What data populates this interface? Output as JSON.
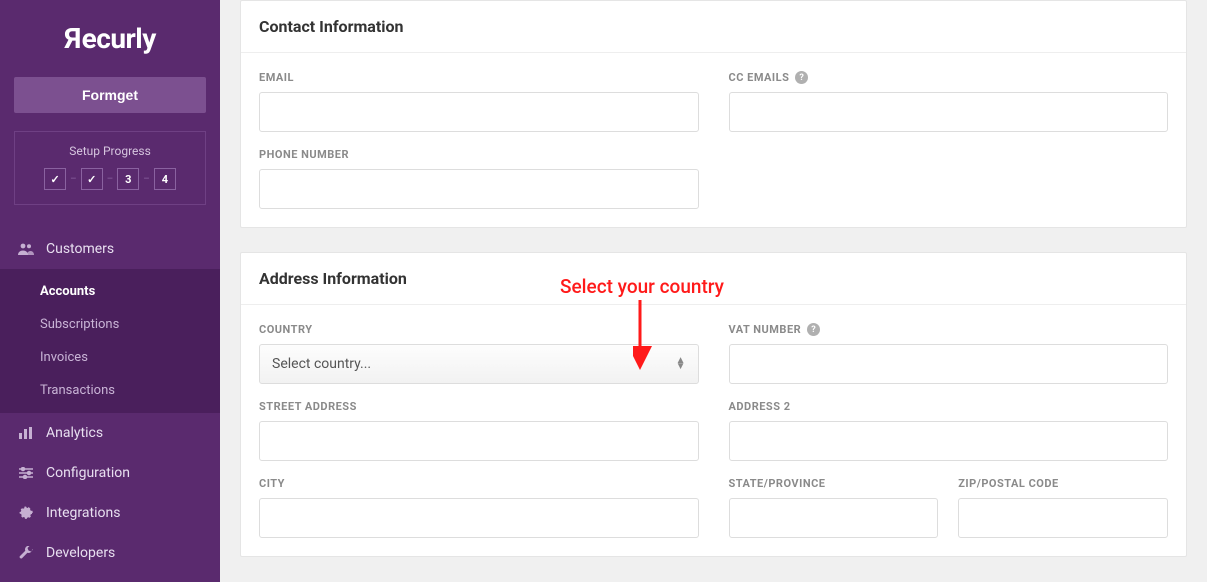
{
  "brand": "Recurly",
  "org_button": "Formget",
  "setup": {
    "title": "Setup Progress",
    "steps": [
      "✓",
      "✓",
      "3",
      "4"
    ]
  },
  "nav": {
    "customers": {
      "label": "Customers"
    },
    "sub": {
      "accounts": "Accounts",
      "subscriptions": "Subscriptions",
      "invoices": "Invoices",
      "transactions": "Transactions"
    },
    "analytics": "Analytics",
    "configuration": "Configuration",
    "integrations": "Integrations",
    "developers": "Developers"
  },
  "contact": {
    "heading": "Contact Information",
    "email_label": "EMAIL",
    "cc_label": "CC EMAILS",
    "phone_label": "PHONE NUMBER"
  },
  "address": {
    "heading": "Address Information",
    "country_label": "COUNTRY",
    "country_placeholder": "Select country...",
    "vat_label": "VAT NUMBER",
    "street_label": "STREET ADDRESS",
    "address2_label": "ADDRESS 2",
    "city_label": "CITY",
    "state_label": "STATE/PROVINCE",
    "zip_label": "ZIP/POSTAL CODE"
  },
  "annotation": "Select your country"
}
